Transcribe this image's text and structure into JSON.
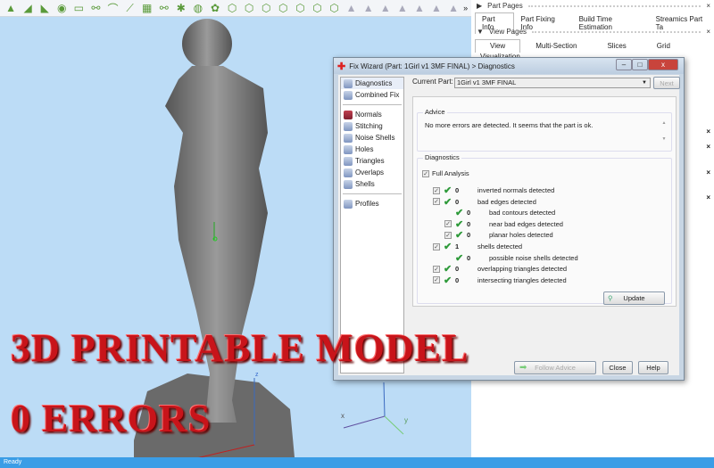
{
  "toolbar": {
    "icons": [
      "part-tool",
      "surface-tool",
      "shell-tool",
      "sphere-tool",
      "rect-tool",
      "link-tool",
      "curve-tool",
      "line-tool",
      "mesh-tool",
      "node-tool",
      "star-tool",
      "wheel-tool",
      "leaf-tool",
      "cube-tool-1",
      "cube-tool-2",
      "cube-tool-3",
      "cube-tool-4",
      "cube-tool-5",
      "cube-tool-6",
      "cube-tool-7",
      "triangle-tool-1",
      "triangle-tool-2",
      "triangle-tool-3",
      "triangle-tool-4",
      "triangle-tool-5",
      "triangle-tool-6",
      "triangle-tool-7"
    ],
    "more": "»"
  },
  "right_panel": {
    "part_pages": "Part Pages",
    "part_tabs": [
      "Part Info",
      "Part Fixing Info",
      "Build Time Estimation",
      "Streamics Part Ta"
    ],
    "view_pages": "View Pages",
    "view_tabs": [
      "View",
      "Multi-Section",
      "Slices",
      "Grid"
    ],
    "visualization": "Visualization",
    "close": "×"
  },
  "dialog": {
    "title": "Fix Wizard (Part: 1Girl v1 3MF FINAL) > Diagnostics",
    "minimize": "–",
    "maximize": "□",
    "close": "x",
    "nav_top": [
      "Diagnostics",
      "Combined Fix"
    ],
    "nav_tools": [
      "Normals",
      "Stitching",
      "Noise Shells",
      "Holes",
      "Triangles",
      "Overlaps",
      "Shells"
    ],
    "nav_bottom": [
      "Profiles"
    ],
    "current_part_label": "Current Part:",
    "current_part_value": "1Girl v1 3MF FINAL",
    "next": "Next",
    "advice_label": "Advice",
    "advice_text": "No more errors are detected. It seems that the part is ok.",
    "diagnostics_label": "Diagnostics",
    "full_analysis": "Full Analysis",
    "rows": [
      {
        "level": 1,
        "checkbox": true,
        "count": "0",
        "label": "inverted normals detected"
      },
      {
        "level": 1,
        "checkbox": true,
        "count": "0",
        "label": "bad edges detected"
      },
      {
        "level": 2,
        "checkbox": false,
        "count": "0",
        "label": "bad contours detected"
      },
      {
        "level": 2,
        "checkbox": true,
        "count": "0",
        "label": "near bad edges detected"
      },
      {
        "level": 2,
        "checkbox": true,
        "count": "0",
        "label": "planar holes detected"
      },
      {
        "level": 1,
        "checkbox": true,
        "count": "1",
        "label": "shells detected"
      },
      {
        "level": 2,
        "checkbox": false,
        "count": "0",
        "label": "possible noise shells detected"
      },
      {
        "level": 1,
        "checkbox": true,
        "count": "0",
        "label": "overlapping triangles detected"
      },
      {
        "level": 1,
        "checkbox": true,
        "count": "0",
        "label": "intersecting triangles detected"
      }
    ],
    "update": "Update",
    "follow_advice": "Follow Advice",
    "close_btn": "Close",
    "help": "Help"
  },
  "overlay": {
    "line1": "3D PRINTABLE MODEL",
    "line2": "0 ERRORS"
  },
  "status": "Ready",
  "axes": {
    "x": "x",
    "y": "y",
    "z": "z"
  }
}
